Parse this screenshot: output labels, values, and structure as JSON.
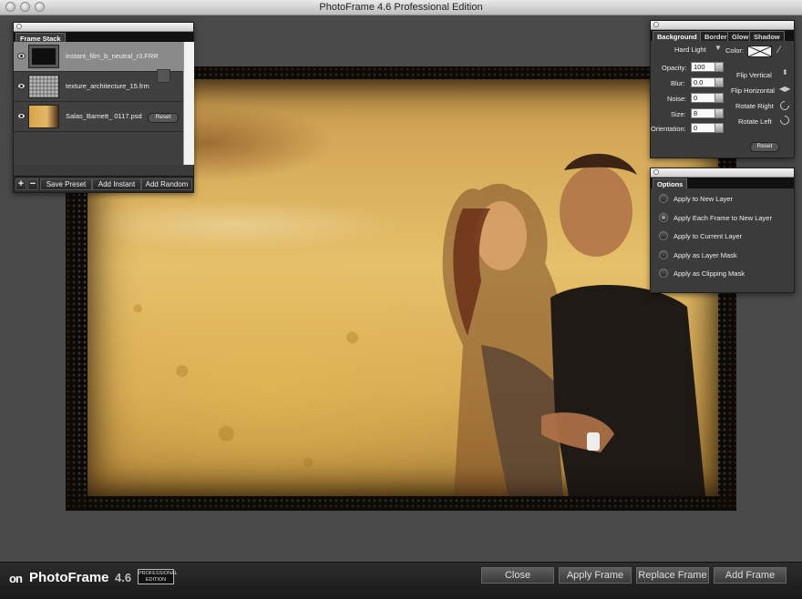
{
  "window": {
    "title": "PhotoFrame 4.6 Professional Edition"
  },
  "frame_stack": {
    "tab": "Frame Stack",
    "items": [
      {
        "name": "instant_film_b_neutral_r3.FRR",
        "selected": true
      },
      {
        "name": "texture_architecture_15.frm",
        "selected": false
      },
      {
        "name": "Salas_Barnett_ 0117.psd",
        "selected": false,
        "reset_label": "Reset"
      }
    ],
    "toolbar": {
      "add_label": "+",
      "remove_label": "−",
      "save_preset": "Save Preset",
      "add_instant": "Add Instant",
      "add_random": "Add Random"
    }
  },
  "background_panel": {
    "tabs": [
      "Background",
      "Border",
      "Glow",
      "Shadow"
    ],
    "active_tab": "Background",
    "blend_mode": "Hard Light",
    "color_label": "Color:",
    "fields": [
      {
        "label": "Opacity:",
        "value": "100"
      },
      {
        "label": "Blur:",
        "value": "0.0"
      },
      {
        "label": "Noise:",
        "value": "0"
      },
      {
        "label": "Size:",
        "value": "8"
      },
      {
        "label": "Orientation:",
        "value": "0"
      }
    ],
    "actions": {
      "flip_vertical": "Flip Vertical",
      "flip_horizontal": "Flip Horizontal",
      "rotate_right": "Rotate Right",
      "rotate_left": "Rotate Left"
    },
    "reset_label": "Reset"
  },
  "options_panel": {
    "tab": "Options",
    "options": [
      {
        "label": "Apply to New Layer",
        "selected": false
      },
      {
        "label": "Apply Each Frame to New Layer",
        "selected": true
      },
      {
        "label": "Apply to Current Layer",
        "selected": false
      },
      {
        "label": "Apply as Layer Mask",
        "selected": false
      },
      {
        "label": "Apply as Clipping Mask",
        "selected": false
      }
    ]
  },
  "bottom_bar": {
    "logo_on": "on",
    "logo_name": "PhotoFrame",
    "logo_version": "4.6",
    "logo_edition": "PROFESSIONAL EDITION",
    "buttons": {
      "close": "Close",
      "apply_frame": "Apply Frame",
      "replace_frame": "Replace Frame",
      "add_frame": "Add Frame"
    }
  }
}
